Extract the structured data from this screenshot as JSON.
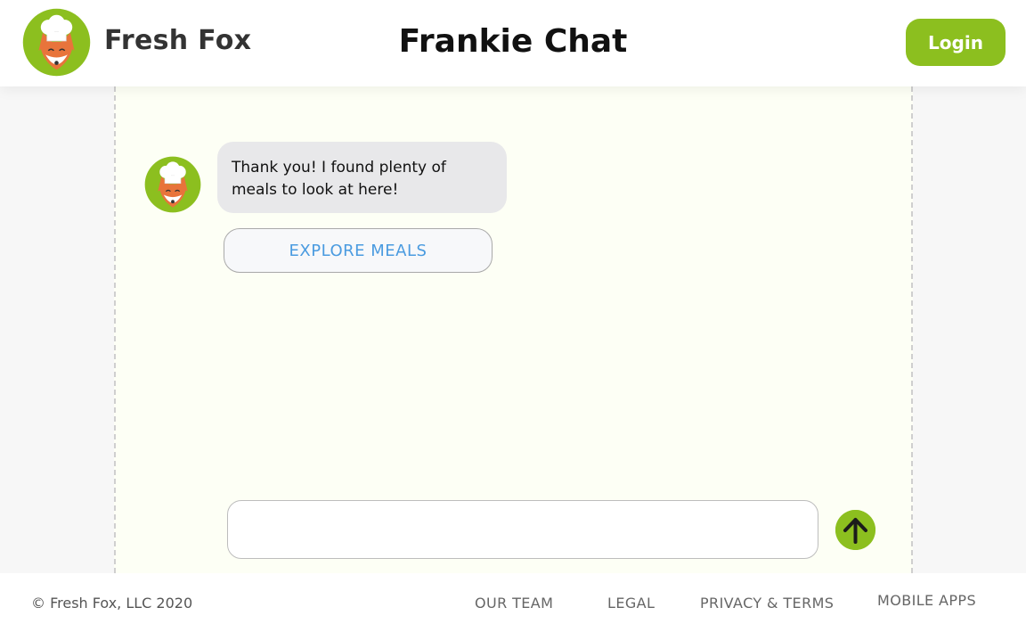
{
  "header": {
    "brand": "Fresh Fox",
    "title": "Frankie Chat",
    "login_label": "Login"
  },
  "chat": {
    "messages": [
      {
        "sender": "bot",
        "text": "Thank you! I found plenty of meals to look at here!"
      }
    ],
    "action_button_label": "EXPLORE MEALS",
    "input_value": "",
    "input_placeholder": ""
  },
  "footer": {
    "copyright": "© Fresh Fox, LLC 2020",
    "links": [
      "OUR TEAM",
      "LEGAL",
      "PRIVACY & TERMS",
      "MOBILE APPS"
    ]
  },
  "colors": {
    "accent": "#8cbf1f",
    "link_blue": "#4a9be0",
    "bubble_gray": "#e8e8ea",
    "chat_background": "#fdfff5"
  },
  "icons": {
    "logo": "fox-chef-logo-icon",
    "avatar": "fox-chef-avatar-icon",
    "send": "arrow-up-icon"
  }
}
